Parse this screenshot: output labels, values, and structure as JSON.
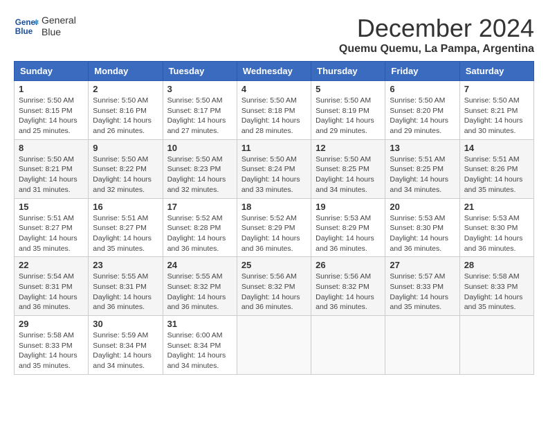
{
  "logo": {
    "line1": "General",
    "line2": "Blue"
  },
  "title": "December 2024",
  "subtitle": "Quemu Quemu, La Pampa, Argentina",
  "days_of_week": [
    "Sunday",
    "Monday",
    "Tuesday",
    "Wednesday",
    "Thursday",
    "Friday",
    "Saturday"
  ],
  "weeks": [
    [
      {
        "day": "1",
        "info": "Sunrise: 5:50 AM\nSunset: 8:15 PM\nDaylight: 14 hours\nand 25 minutes."
      },
      {
        "day": "2",
        "info": "Sunrise: 5:50 AM\nSunset: 8:16 PM\nDaylight: 14 hours\nand 26 minutes."
      },
      {
        "day": "3",
        "info": "Sunrise: 5:50 AM\nSunset: 8:17 PM\nDaylight: 14 hours\nand 27 minutes."
      },
      {
        "day": "4",
        "info": "Sunrise: 5:50 AM\nSunset: 8:18 PM\nDaylight: 14 hours\nand 28 minutes."
      },
      {
        "day": "5",
        "info": "Sunrise: 5:50 AM\nSunset: 8:19 PM\nDaylight: 14 hours\nand 29 minutes."
      },
      {
        "day": "6",
        "info": "Sunrise: 5:50 AM\nSunset: 8:20 PM\nDaylight: 14 hours\nand 29 minutes."
      },
      {
        "day": "7",
        "info": "Sunrise: 5:50 AM\nSunset: 8:21 PM\nDaylight: 14 hours\nand 30 minutes."
      }
    ],
    [
      {
        "day": "8",
        "info": "Sunrise: 5:50 AM\nSunset: 8:21 PM\nDaylight: 14 hours\nand 31 minutes."
      },
      {
        "day": "9",
        "info": "Sunrise: 5:50 AM\nSunset: 8:22 PM\nDaylight: 14 hours\nand 32 minutes."
      },
      {
        "day": "10",
        "info": "Sunrise: 5:50 AM\nSunset: 8:23 PM\nDaylight: 14 hours\nand 32 minutes."
      },
      {
        "day": "11",
        "info": "Sunrise: 5:50 AM\nSunset: 8:24 PM\nDaylight: 14 hours\nand 33 minutes."
      },
      {
        "day": "12",
        "info": "Sunrise: 5:50 AM\nSunset: 8:25 PM\nDaylight: 14 hours\nand 34 minutes."
      },
      {
        "day": "13",
        "info": "Sunrise: 5:51 AM\nSunset: 8:25 PM\nDaylight: 14 hours\nand 34 minutes."
      },
      {
        "day": "14",
        "info": "Sunrise: 5:51 AM\nSunset: 8:26 PM\nDaylight: 14 hours\nand 35 minutes."
      }
    ],
    [
      {
        "day": "15",
        "info": "Sunrise: 5:51 AM\nSunset: 8:27 PM\nDaylight: 14 hours\nand 35 minutes."
      },
      {
        "day": "16",
        "info": "Sunrise: 5:51 AM\nSunset: 8:27 PM\nDaylight: 14 hours\nand 35 minutes."
      },
      {
        "day": "17",
        "info": "Sunrise: 5:52 AM\nSunset: 8:28 PM\nDaylight: 14 hours\nand 36 minutes."
      },
      {
        "day": "18",
        "info": "Sunrise: 5:52 AM\nSunset: 8:29 PM\nDaylight: 14 hours\nand 36 minutes."
      },
      {
        "day": "19",
        "info": "Sunrise: 5:53 AM\nSunset: 8:29 PM\nDaylight: 14 hours\nand 36 minutes."
      },
      {
        "day": "20",
        "info": "Sunrise: 5:53 AM\nSunset: 8:30 PM\nDaylight: 14 hours\nand 36 minutes."
      },
      {
        "day": "21",
        "info": "Sunrise: 5:53 AM\nSunset: 8:30 PM\nDaylight: 14 hours\nand 36 minutes."
      }
    ],
    [
      {
        "day": "22",
        "info": "Sunrise: 5:54 AM\nSunset: 8:31 PM\nDaylight: 14 hours\nand 36 minutes."
      },
      {
        "day": "23",
        "info": "Sunrise: 5:55 AM\nSunset: 8:31 PM\nDaylight: 14 hours\nand 36 minutes."
      },
      {
        "day": "24",
        "info": "Sunrise: 5:55 AM\nSunset: 8:32 PM\nDaylight: 14 hours\nand 36 minutes."
      },
      {
        "day": "25",
        "info": "Sunrise: 5:56 AM\nSunset: 8:32 PM\nDaylight: 14 hours\nand 36 minutes."
      },
      {
        "day": "26",
        "info": "Sunrise: 5:56 AM\nSunset: 8:32 PM\nDaylight: 14 hours\nand 36 minutes."
      },
      {
        "day": "27",
        "info": "Sunrise: 5:57 AM\nSunset: 8:33 PM\nDaylight: 14 hours\nand 35 minutes."
      },
      {
        "day": "28",
        "info": "Sunrise: 5:58 AM\nSunset: 8:33 PM\nDaylight: 14 hours\nand 35 minutes."
      }
    ],
    [
      {
        "day": "29",
        "info": "Sunrise: 5:58 AM\nSunset: 8:33 PM\nDaylight: 14 hours\nand 35 minutes."
      },
      {
        "day": "30",
        "info": "Sunrise: 5:59 AM\nSunset: 8:34 PM\nDaylight: 14 hours\nand 34 minutes."
      },
      {
        "day": "31",
        "info": "Sunrise: 6:00 AM\nSunset: 8:34 PM\nDaylight: 14 hours\nand 34 minutes."
      },
      {
        "day": "",
        "info": ""
      },
      {
        "day": "",
        "info": ""
      },
      {
        "day": "",
        "info": ""
      },
      {
        "day": "",
        "info": ""
      }
    ]
  ]
}
